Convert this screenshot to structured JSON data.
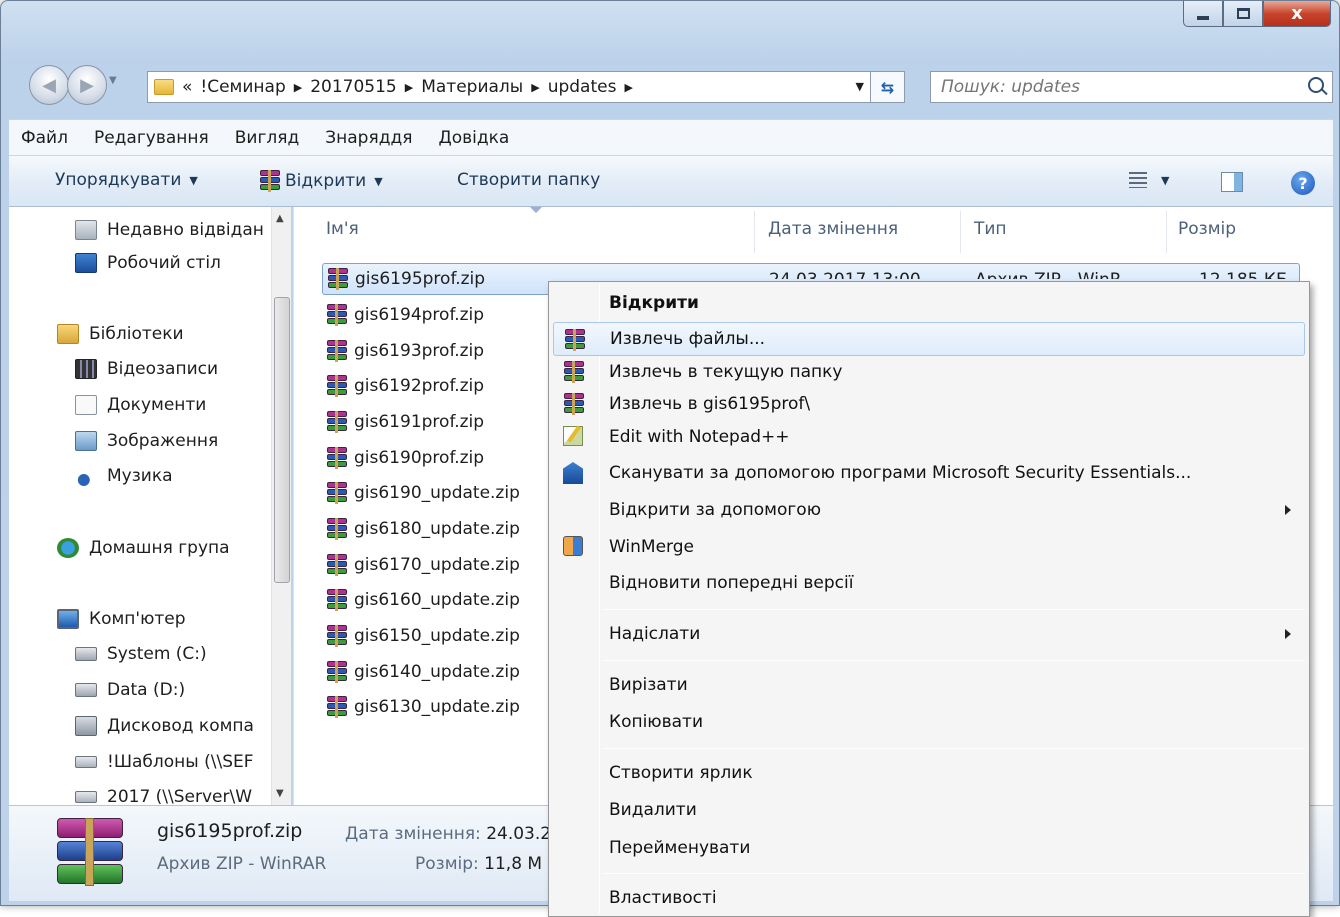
{
  "window": {
    "close_label": "x"
  },
  "address_bar": {
    "overflow": "«",
    "crumbs": [
      "!Семинар",
      "20170515",
      "Материалы",
      "updates"
    ]
  },
  "search": {
    "placeholder": "Пошук: updates"
  },
  "menu": [
    "Файл",
    "Редагування",
    "Вигляд",
    "Знаряддя",
    "Довідка"
  ],
  "toolbar": {
    "organize": "Упорядкувати",
    "open": "Відкрити",
    "new_folder": "Створити папку",
    "icons": [
      "view-options-icon",
      "preview-pane-icon",
      "help-icon"
    ]
  },
  "navigation": {
    "items": [
      {
        "label": "Недавно відвідан",
        "icon": "recent-places-icon"
      },
      {
        "label": "Робочий стіл",
        "icon": "desktop-icon"
      },
      {
        "label": "Бібліотеки",
        "icon": "libraries-icon"
      },
      {
        "label": "Відеозаписи",
        "icon": "videos-icon"
      },
      {
        "label": "Документи",
        "icon": "documents-icon"
      },
      {
        "label": "Зображення",
        "icon": "pictures-icon"
      },
      {
        "label": "Музика",
        "icon": "music-icon"
      },
      {
        "label": "Домашня група",
        "icon": "homegroup-icon"
      },
      {
        "label": "Комп'ютер",
        "icon": "computer-icon"
      },
      {
        "label": "System (C:)",
        "icon": "system-drive-icon"
      },
      {
        "label": "Data (D:)",
        "icon": "drive-icon"
      },
      {
        "label": "Дисковод компа",
        "icon": "cd-drive-icon"
      },
      {
        "label": "!Шаблоны (\\\\SEF",
        "icon": "network-drive-icon"
      },
      {
        "label": "2017 (\\\\Server\\W",
        "icon": "network-drive-icon"
      }
    ]
  },
  "file_list": {
    "columns": [
      "Ім'я",
      "Дата змінення",
      "Тип",
      "Розмір"
    ],
    "selected_row": {
      "date": "24.03.2017 13:00",
      "type": "Архив ZIP - WinR",
      "size": "12 185 КБ"
    },
    "files": [
      "gis6195prof.zip",
      "gis6194prof.zip",
      "gis6193prof.zip",
      "gis6192prof.zip",
      "gis6191prof.zip",
      "gis6190prof.zip",
      "gis6190_update.zip",
      "gis6180_update.zip",
      "gis6170_update.zip",
      "gis6160_update.zip",
      "gis6150_update.zip",
      "gis6140_update.zip",
      "gis6130_update.zip"
    ]
  },
  "details": {
    "name": "gis6195prof.zip",
    "type": "Архив ZIP - WinRAR",
    "modified_label": "Дата змінення:",
    "modified_value": "24.03.2",
    "size_label": "Розмір:",
    "size_value": "11,8 М"
  },
  "context_menu": {
    "items": [
      {
        "label": "Відкрити",
        "bold": true
      },
      {
        "label": "Извлечь файлы...",
        "icon": "winrar-icon",
        "hover": true
      },
      {
        "label": "Извлечь в текущую папку",
        "icon": "winrar-icon"
      },
      {
        "label": "Извлечь в gis6195prof\\",
        "icon": "winrar-icon"
      },
      {
        "label": "Edit with Notepad++",
        "icon": "notepadpp-icon"
      },
      {
        "label": "Сканувати за допомогою програми Microsoft Security Essentials...",
        "icon": "security-essentials-icon"
      },
      {
        "label": "Відкрити за допомогою",
        "submenu": true
      },
      {
        "label": "WinMerge",
        "icon": "winmerge-icon"
      },
      {
        "label": "Відновити попередні версії"
      },
      {
        "label": "Надіслати",
        "submenu": true
      },
      {
        "label": "Вирізати"
      },
      {
        "label": "Копіювати"
      },
      {
        "label": "Створити ярлик"
      },
      {
        "label": "Видалити"
      },
      {
        "label": "Перейменувати"
      },
      {
        "label": "Властивості"
      }
    ]
  }
}
